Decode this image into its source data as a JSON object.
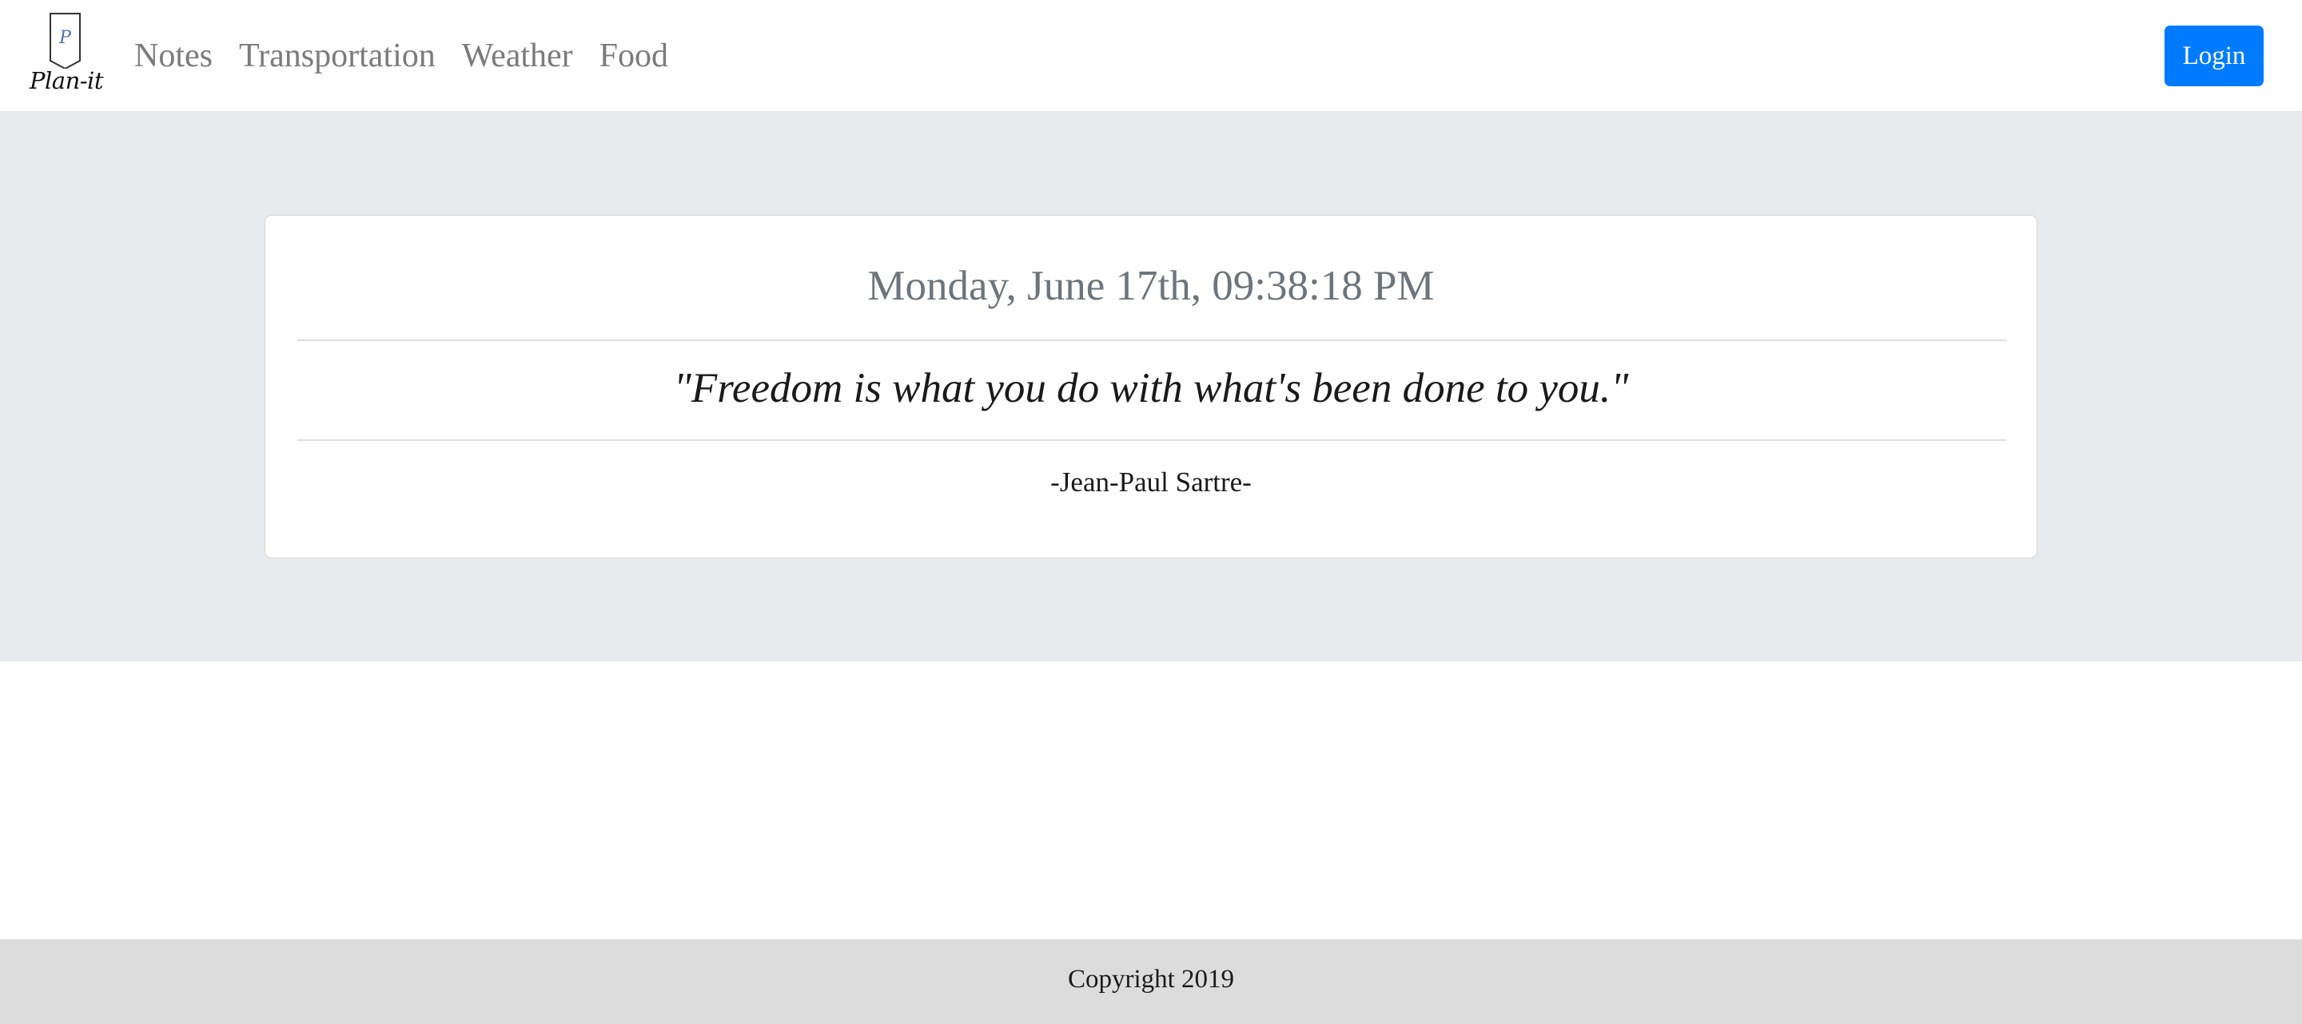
{
  "brand": {
    "name": "Plan-it",
    "logo_letter": "P"
  },
  "nav": {
    "links": [
      {
        "label": "Notes"
      },
      {
        "label": "Transportation"
      },
      {
        "label": "Weather"
      },
      {
        "label": "Food"
      }
    ],
    "login_label": "Login"
  },
  "main": {
    "datetime": "Monday, June 17th, 09:38:18 PM",
    "quote": "\"Freedom is what you do with what's been done to you.\"",
    "author": "-Jean-Paul Sartre-"
  },
  "footer": {
    "text": "Copyright 2019"
  },
  "colors": {
    "primary": "#007bff",
    "jumbotron_bg": "#e8ebee",
    "footer_bg": "#dcdcdc",
    "muted_text": "#6c757d"
  },
  "icons": {
    "logo": "bookmark-logo-icon"
  }
}
